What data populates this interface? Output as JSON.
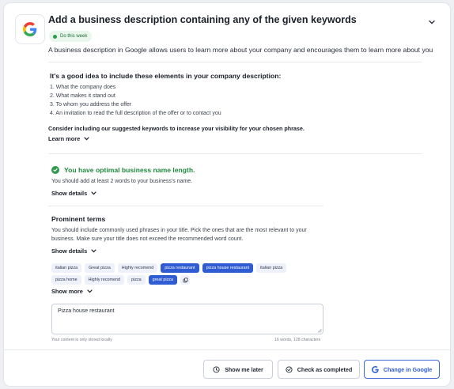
{
  "header": {
    "title": "Add a business description containing any of the given keywords",
    "badge": "Do this week",
    "description": "A business description in Google allows users to learn more about your company and encourages them to learn more about you or"
  },
  "tips": {
    "heading": "It's a good idea to include these elements in your company description:",
    "items": [
      "1. What the company does",
      "2. What makes it stand out",
      "3. To whom you address the offer",
      "4. An invitation to read the full description of the offer or to contact you"
    ],
    "consider": "Consider including our suggested keywords to increase your visibility for your chosen phrase.",
    "learn_more": "Learn more"
  },
  "name_check": {
    "status": "You have optimal business name length.",
    "detail": "You should add at least 2 words to your business's name.",
    "show_details": "Show details"
  },
  "prominent": {
    "heading": "Prominent terms",
    "text_line1": "You should include commonly used phrases in your title. Pick the ones that are the most relevant to your",
    "text_line2": "business. Make sure your title does not exceed the recommended word count.",
    "show_details": "Show details",
    "tags_row1": [
      {
        "label": "italian pizza",
        "selected": false
      },
      {
        "label": "Great pizza",
        "selected": false
      },
      {
        "label": "Highly recomend",
        "selected": false
      },
      {
        "label": "pizza restaurant",
        "selected": true
      },
      {
        "label": "pizza house restaurant",
        "selected": true
      },
      {
        "label": "italian pizza",
        "selected": false
      }
    ],
    "tags_row2": [
      {
        "label": "pizza home",
        "selected": false
      },
      {
        "label": "Highly recomend",
        "selected": false
      },
      {
        "label": "pizza",
        "selected": false
      },
      {
        "label": "great pizza",
        "selected": true
      }
    ],
    "tag_icon": "copy-icon",
    "show_more": "Show more"
  },
  "editor": {
    "value": "Pizza house restaurant",
    "storage_note": "Your content is only stored locally",
    "counter": "16 words, 128 characters"
  },
  "footer": {
    "show_later": "Show me later",
    "check_completed": "Check as completed",
    "change_google": "Change in Google"
  },
  "colors": {
    "accent": "#2f5bd3",
    "success": "#2e9a4a",
    "badge_bg": "#e8f6ec"
  }
}
